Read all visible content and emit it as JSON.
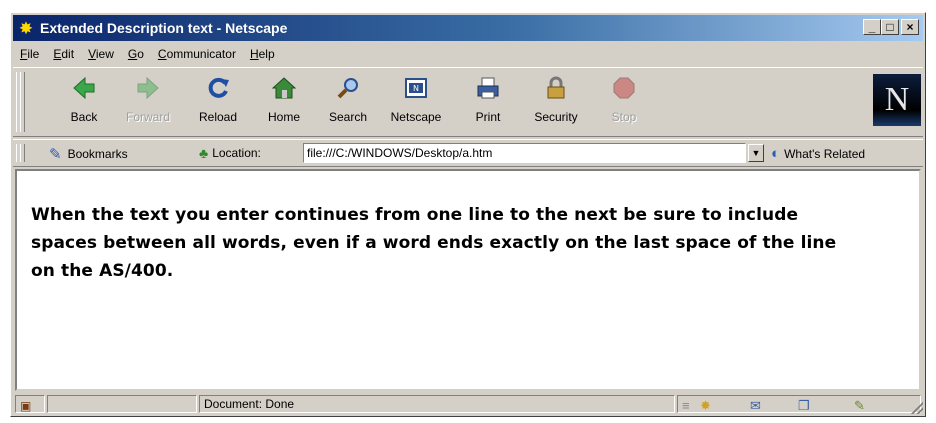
{
  "window": {
    "title": "Extended Description text - Netscape",
    "controls": {
      "minimize": "_",
      "maximize": "□",
      "close": "×"
    }
  },
  "menu": [
    {
      "key": "F",
      "rest": "ile"
    },
    {
      "key": "E",
      "rest": "dit"
    },
    {
      "key": "V",
      "rest": "iew"
    },
    {
      "key": "G",
      "rest": "o"
    },
    {
      "key": "C",
      "rest": "ommunicator"
    },
    {
      "key": "H",
      "rest": "elp"
    }
  ],
  "toolbar": {
    "back": "Back",
    "forward": "Forward",
    "reload": "Reload",
    "home": "Home",
    "search": "Search",
    "netscape": "Netscape",
    "print": "Print",
    "security": "Security",
    "stop": "Stop",
    "logo": "N"
  },
  "location_bar": {
    "bookmarks": "Bookmarks",
    "location_label": "Location:",
    "url": "file:///C:/WINDOWS/Desktop/a.htm",
    "whats_related": "What's Related"
  },
  "content": {
    "text": "When the text you enter continues from one line to the next be sure to include spaces between all words, even if a word ends exactly on the last space of the line on the AS/400."
  },
  "status": {
    "text": "Document: Done"
  }
}
